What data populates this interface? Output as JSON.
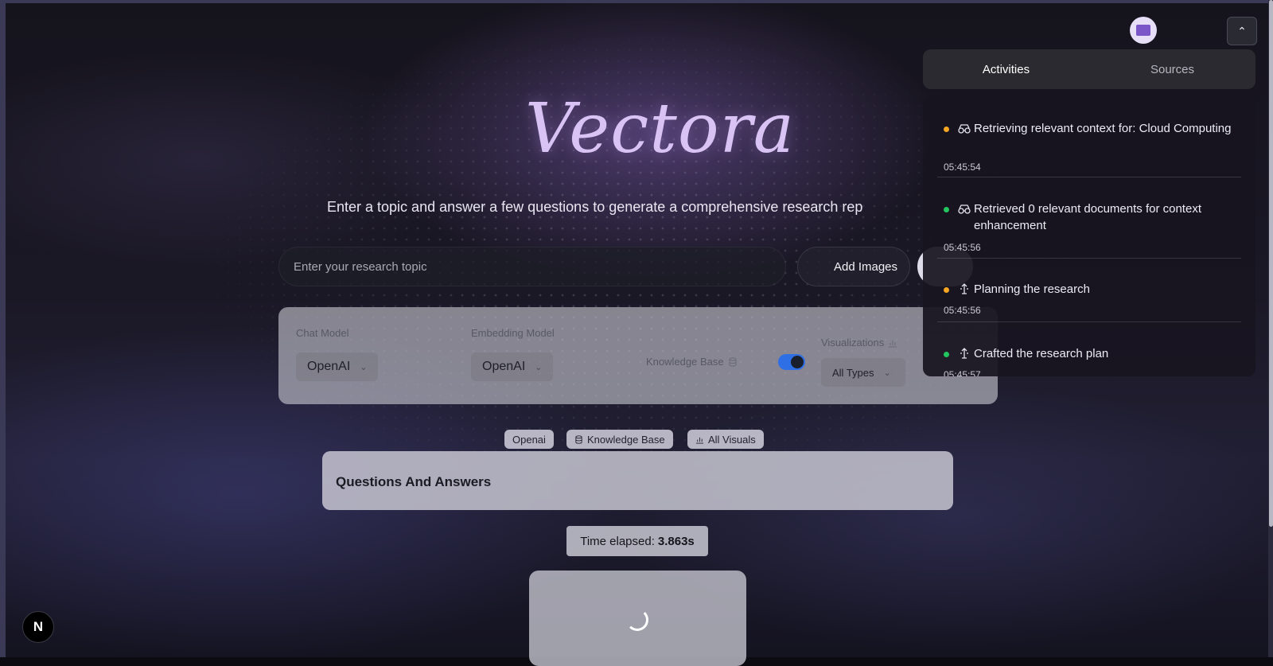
{
  "app": {
    "logo_text": "Vectora",
    "tagline": "Enter a topic and answer a few questions to generate a comprehensive research rep"
  },
  "search": {
    "placeholder": "Enter your research topic",
    "value": "",
    "add_images_label": "Add Images"
  },
  "settings": {
    "chat_model_label": "Chat Model",
    "chat_model_value": "OpenAI",
    "embedding_model_label": "Embedding Model",
    "embedding_model_value": "OpenAI",
    "knowledge_base_label": "Knowledge Base",
    "knowledge_base_enabled": true,
    "visualizations_label": "Visualizations",
    "visualizations_value": "All Types"
  },
  "chips": [
    {
      "label": "Openai",
      "icon": ""
    },
    {
      "label": "Knowledge Base",
      "icon": "database-icon"
    },
    {
      "label": "All Visuals",
      "icon": "bar-chart-icon"
    }
  ],
  "qa": {
    "title": "Questions And Answers"
  },
  "timer": {
    "label": "Time elapsed:",
    "value": "3.863s"
  },
  "panel": {
    "tabs": [
      {
        "label": "Activities",
        "active": true
      },
      {
        "label": "Sources",
        "active": false
      }
    ],
    "activities": [
      {
        "status_color": "#f5a623",
        "icon": "glasses-icon",
        "text": "Retrieving relevant context for: Cloud Computing",
        "time": "05:45:54"
      },
      {
        "status_color": "#22c55e",
        "icon": "glasses-icon",
        "text": "Retrieved 0 relevant documents for context enhancement",
        "time": "05:45:56"
      },
      {
        "status_color": "#f5a623",
        "icon": "planning-icon",
        "text": "Planning the research",
        "time": "05:45:56"
      },
      {
        "status_color": "#22c55e",
        "icon": "planning-icon",
        "text": "Crafted the research plan",
        "time": "05:45:57"
      }
    ]
  },
  "misc": {
    "nextjs_badge": "N"
  },
  "colors": {
    "accent": "#2f6fe6",
    "logo": "#d9c3f4",
    "pending": "#f5a623",
    "done": "#22c55e"
  }
}
